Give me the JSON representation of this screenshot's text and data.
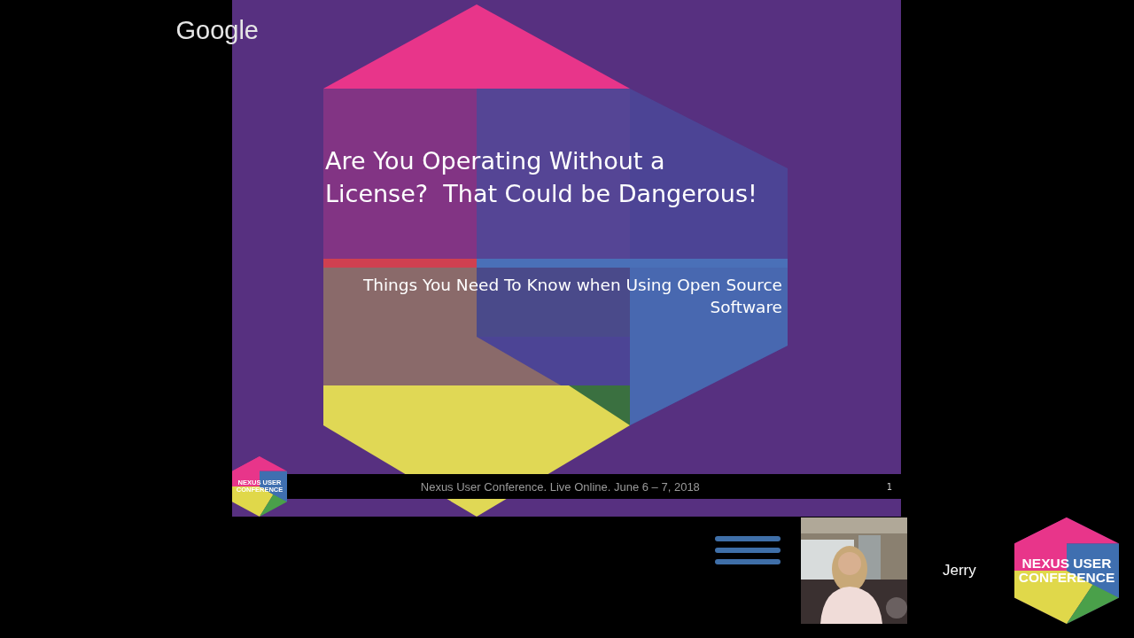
{
  "brand": {
    "logo": "Google"
  },
  "slide": {
    "title_lines": [
      "Are You Operating Without a",
      "License?  That Could be Dangerous!"
    ],
    "subtitle_lines": [
      "Things You Need To Know when Using Open Source",
      "Software"
    ],
    "footer": {
      "logo_lines": [
        "NEXUS USER",
        "CONFERENCE"
      ],
      "text": "Nexus User Conference. Live Online. June 6 – 7, 2018",
      "page_number": "1"
    }
  },
  "participant": {
    "name": "Jerry"
  },
  "conference_logo": {
    "lines": [
      "NEXUS USER",
      "CONFERENCE"
    ]
  }
}
